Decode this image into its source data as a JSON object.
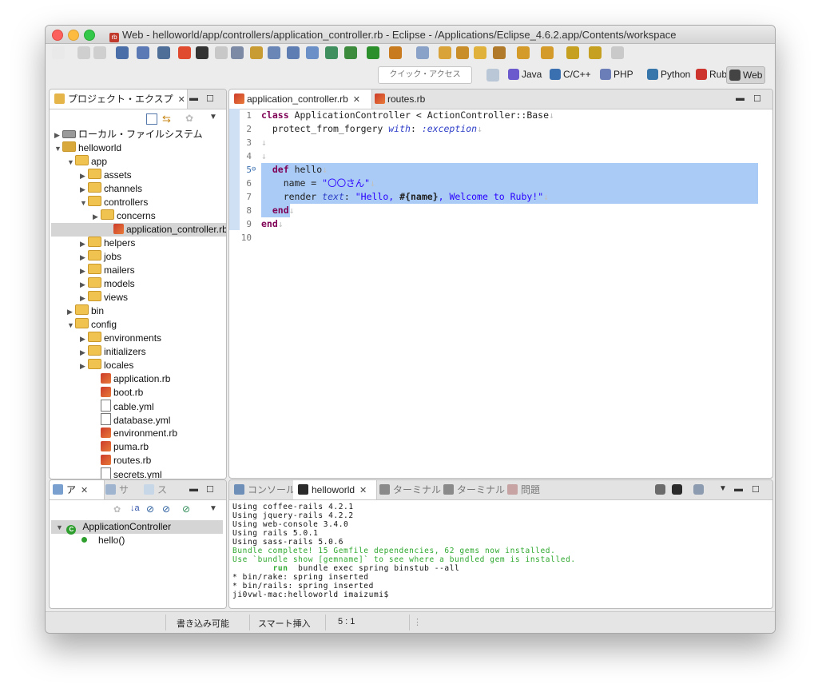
{
  "window": {
    "title": "Web - helloworld/app/controllers/application_controller.rb - Eclipse - /Applications/Eclipse_4.6.2.app/Contents/workspace"
  },
  "toolbar": {
    "quick_access_placeholder": "クイック・アクセス",
    "perspectives": [
      {
        "label": "Java",
        "color": "#6a5acd"
      },
      {
        "label": "C/C++",
        "color": "#3a6fb0"
      },
      {
        "label": "PHP",
        "color": "#6c7eb7"
      },
      {
        "label": "Python",
        "color": "#3776ab"
      },
      {
        "label": "Ruby",
        "color": "#cc342d"
      },
      {
        "label": "Web",
        "color": "#444444"
      }
    ]
  },
  "project_explorer": {
    "tab_label": "プロジェクト・エクスプ",
    "items": [
      {
        "label": "ローカル・ファイルシステム",
        "type": "drive",
        "depth": 0,
        "expanded": false
      },
      {
        "label": "helloworld",
        "type": "project",
        "depth": 0,
        "expanded": true
      },
      {
        "label": "app",
        "type": "folder",
        "depth": 1,
        "expanded": true
      },
      {
        "label": "assets",
        "type": "folder",
        "depth": 2,
        "expanded": false
      },
      {
        "label": "channels",
        "type": "folder",
        "depth": 2,
        "expanded": false
      },
      {
        "label": "controllers",
        "type": "folder",
        "depth": 2,
        "expanded": true
      },
      {
        "label": "concerns",
        "type": "folder",
        "depth": 3,
        "expanded": false
      },
      {
        "label": "application_controller.rb",
        "type": "rb",
        "depth": 4,
        "selected": true
      },
      {
        "label": "helpers",
        "type": "folder",
        "depth": 2,
        "expanded": false
      },
      {
        "label": "jobs",
        "type": "folder",
        "depth": 2,
        "expanded": false
      },
      {
        "label": "mailers",
        "type": "folder",
        "depth": 2,
        "expanded": false
      },
      {
        "label": "models",
        "type": "folder",
        "depth": 2,
        "expanded": false
      },
      {
        "label": "views",
        "type": "folder",
        "depth": 2,
        "expanded": false
      },
      {
        "label": "bin",
        "type": "folder",
        "depth": 1,
        "expanded": false
      },
      {
        "label": "config",
        "type": "folder",
        "depth": 1,
        "expanded": true
      },
      {
        "label": "environments",
        "type": "folder",
        "depth": 2,
        "expanded": false
      },
      {
        "label": "initializers",
        "type": "folder",
        "depth": 2,
        "expanded": false
      },
      {
        "label": "locales",
        "type": "folder",
        "depth": 2,
        "expanded": false
      },
      {
        "label": "application.rb",
        "type": "rb",
        "depth": 3
      },
      {
        "label": "boot.rb",
        "type": "rb",
        "depth": 3
      },
      {
        "label": "cable.yml",
        "type": "yml",
        "depth": 3
      },
      {
        "label": "database.yml",
        "type": "yml",
        "depth": 3
      },
      {
        "label": "environment.rb",
        "type": "rb",
        "depth": 3
      },
      {
        "label": "puma.rb",
        "type": "rb",
        "depth": 3
      },
      {
        "label": "routes.rb",
        "type": "rb",
        "depth": 3
      },
      {
        "label": "secrets.yml",
        "type": "yml",
        "depth": 3
      }
    ]
  },
  "outline": {
    "tabs": [
      "ア",
      "サ",
      "ス"
    ],
    "class_name": "ApplicationController",
    "method": "hello()"
  },
  "editor": {
    "tabs": [
      {
        "label": "application_controller.rb",
        "active": true
      },
      {
        "label": "routes.rb",
        "active": false
      }
    ],
    "lines": [
      {
        "num": "1",
        "html": "<span class='kw'>class</span> ApplicationController &lt; ActionController::Base<span class='ws'>↓</span>"
      },
      {
        "num": "2",
        "html": "  protect_from_forgery <span class='sym'>with</span>: <span class='sym'>:exception</span><span class='ws'>↓</span>"
      },
      {
        "num": "3",
        "html": "<span class='ws'>↓</span>"
      },
      {
        "num": "4",
        "html": "<span class='ws'>↓</span>"
      },
      {
        "num": "5",
        "html": "  <span class='kw'>def</span> hello<span class='ws'>↓</span>"
      },
      {
        "num": "6",
        "html": "    name = <span class='str'>\"〇〇さん\"</span><span class='ws'>↓</span>"
      },
      {
        "num": "7",
        "html": "    render <span class='sym'>text</span>: <span class='str'>\"Hello, </span><b>#{name}</b><span class='str'>, Welcome to Ruby!\"</span><span class='ws'>↓</span>"
      },
      {
        "num": "8",
        "html": "  <span class='kw'>end</span><span class='ws'>↓</span>"
      },
      {
        "num": "9",
        "html": "<span class='kw'>end</span><span class='ws'>↓</span>"
      },
      {
        "num": "10",
        "html": ""
      }
    ]
  },
  "console": {
    "tabs": [
      {
        "label": "コンソール",
        "active": false
      },
      {
        "label": "helloworld",
        "active": true
      },
      {
        "label": "ターミナル",
        "active": false
      },
      {
        "label": "ターミナル",
        "active": false
      },
      {
        "label": "問題",
        "active": false
      }
    ],
    "lines": [
      {
        "text": "Using coffee-rails 4.2.1",
        "color": "normal"
      },
      {
        "text": "Using jquery-rails 4.2.2",
        "color": "normal"
      },
      {
        "text": "Using web-console 3.4.0",
        "color": "normal"
      },
      {
        "text": "Using rails 5.0.1",
        "color": "normal"
      },
      {
        "text": "Using sass-rails 5.0.6",
        "color": "normal"
      },
      {
        "text": "Bundle complete! 15 Gemfile dependencies, 62 gems now installed.",
        "color": "green"
      },
      {
        "text": "Use `bundle show [gemname]` to see where a bundled gem is installed.",
        "color": "green"
      },
      {
        "text": "        run  bundle exec spring binstub --all",
        "color": "run"
      },
      {
        "text": "* bin/rake: spring inserted",
        "color": "normal"
      },
      {
        "text": "* bin/rails: spring inserted",
        "color": "normal"
      },
      {
        "text": "ji0vwl-mac:helloworld imaizumi$",
        "color": "normal"
      }
    ]
  },
  "statusbar": {
    "writable": "書き込み可能",
    "insert_mode": "スマート挿入",
    "position": "5 : 1"
  }
}
